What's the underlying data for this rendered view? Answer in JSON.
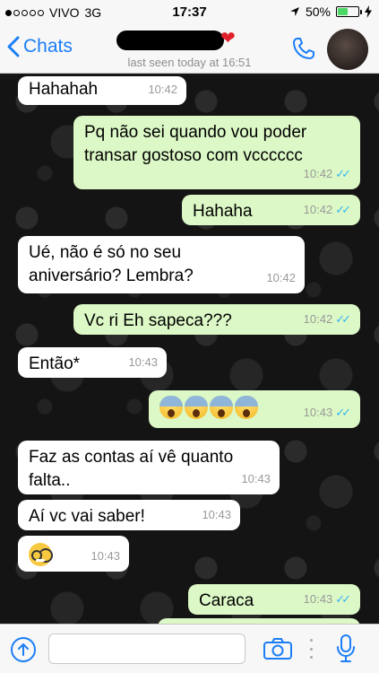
{
  "status_bar": {
    "carrier": "VIVO",
    "network": "3G",
    "time": "17:37",
    "battery": "50%",
    "battery_level": 0.5
  },
  "header": {
    "back_label": "Chats",
    "last_seen": "last seen today at 16:51"
  },
  "messages": [
    {
      "dir": "in",
      "text": "Hahahah",
      "time": "10:42"
    },
    {
      "dir": "out",
      "text": "Pq não sei quando vou poder transar gostoso com vcccccc",
      "time": "10:42"
    },
    {
      "dir": "out",
      "text": "Hahaha",
      "time": "10:42"
    },
    {
      "dir": "in",
      "text": "Ué, não é só no seu aniversário? Lembra?",
      "time": "10:42"
    },
    {
      "dir": "out",
      "text": "Vc ri Eh sapeca???",
      "time": "10:42"
    },
    {
      "dir": "in",
      "text": "Então*",
      "time": "10:43"
    },
    {
      "dir": "out",
      "emoji": "screaming-face x4",
      "time": "10:43"
    },
    {
      "dir": "in",
      "text": "Faz as contas aí vê quanto falta..",
      "time": "10:43"
    },
    {
      "dir": "in",
      "text": "Aí vc vai saber!",
      "time": "10:43"
    },
    {
      "dir": "in",
      "emoji": "nerd-face",
      "time": "10:43"
    },
    {
      "dir": "out",
      "text": "Caraca",
      "time": "10:43"
    }
  ],
  "colors": {
    "accent": "#1b7ef7",
    "outgoing_bubble": "#dcf8c6",
    "incoming_bubble": "#ffffff",
    "read_ticks": "#34b7f1"
  }
}
